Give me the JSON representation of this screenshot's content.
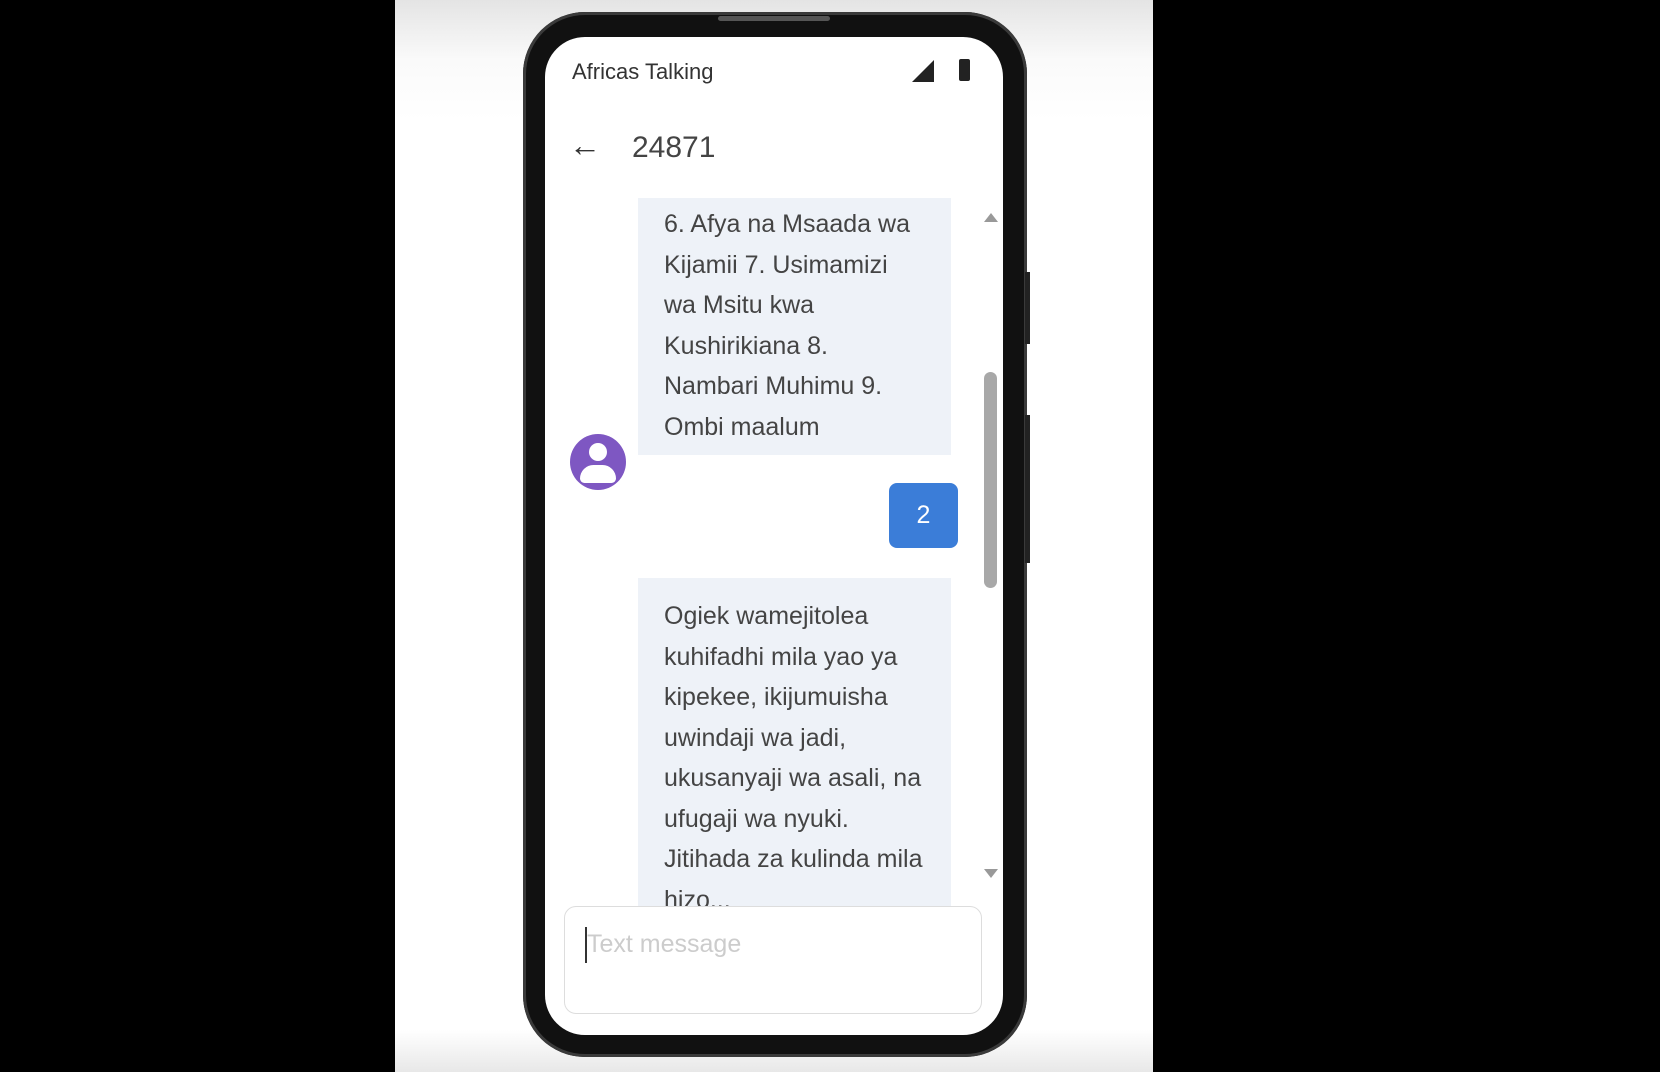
{
  "status_bar": {
    "app_name": "Africas Talking",
    "signal_icon": "signal-icon",
    "battery_icon": "battery-icon"
  },
  "header": {
    "back_icon": "←",
    "title": "24871"
  },
  "messages": [
    {
      "direction": "incoming",
      "text": "6. Afya na Msaada wa Kijamii 7. Usimamizi wa Msitu kwa Kushirikiana 8. Nambari Muhimu 9. Ombi maalum"
    },
    {
      "direction": "outgoing",
      "text": "2"
    },
    {
      "direction": "incoming",
      "text": "Ogiek wamejitolea kuhifadhi mila yao ya kipekee, ikijumuisha uwindaji wa jadi, ukusanyaji wa asali, na ufugaji wa nyuki. Jitihada za kulinda mila hizo..."
    }
  ],
  "composer": {
    "placeholder": "Text message",
    "value": ""
  },
  "colors": {
    "outgoing_bubble": "#3b7dd8",
    "incoming_bubble": "#eef2f8",
    "avatar": "#7e57c2"
  }
}
